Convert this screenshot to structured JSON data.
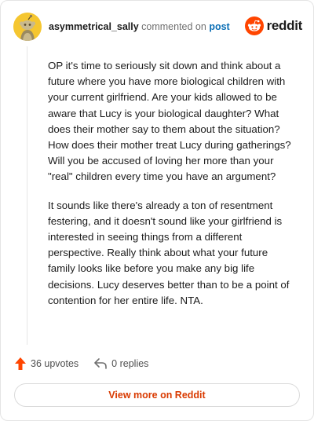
{
  "comment": {
    "username": "asymmetrical_sally",
    "commented_text": "commented on",
    "post_link_text": "post",
    "brand": "reddit",
    "paragraphs": [
      "OP it's time to seriously sit down and think about a future where you have more biological children with your current girlfriend. Are your kids allowed to be aware that Lucy is your biological daughter? What does their mother say to them about the situation? How does their mother treat Lucy during gatherings? Will you be accused of loving her more than your \"real\" children every time you have an argument?",
      "It sounds like there's already a ton of resentment festering, and it doesn't sound like your girlfriend is interested in seeing things from a different perspective. Really think about what your future family looks like before you make any big life decisions. Lucy deserves better than to be a point of contention for her entire life. NTA."
    ],
    "upvotes_label": "36 upvotes",
    "replies_label": "0 replies",
    "view_more_label": "View more on Reddit"
  },
  "colors": {
    "reddit_orange": "#ff4500",
    "link_blue": "#0b6fb5",
    "view_more_text": "#d93a00",
    "avatar_bg": "#f5c630"
  },
  "icons": {
    "avatar": "snoo-avatar-icon",
    "brand": "reddit-logo-icon",
    "upvote": "upvote-arrow-icon",
    "reply": "reply-arrow-icon"
  }
}
